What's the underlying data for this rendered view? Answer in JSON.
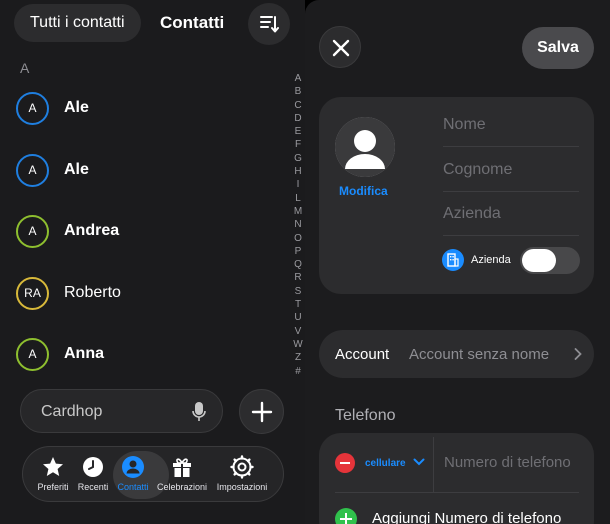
{
  "contacts_list": {
    "filter_label": "Tutti i contatti",
    "title": "Contatti",
    "section_letter": "A",
    "contacts": [
      {
        "initials": "A",
        "name": "Ale",
        "ring_color": "#1f7fe0"
      },
      {
        "initials": "A",
        "name": "Ale",
        "ring_color": "#1f7fe0"
      },
      {
        "initials": "A",
        "name": "Andrea",
        "ring_color": "#8ebf2f"
      },
      {
        "initials": "RA",
        "name": "Roberto",
        "ring_color": "#d8b93a"
      },
      {
        "initials": "A",
        "name": "Anna",
        "ring_color": "#8ebf2f"
      }
    ],
    "alphabet": [
      "A",
      "B",
      "C",
      "D",
      "E",
      "F",
      "G",
      "H",
      "I",
      "L",
      "M",
      "N",
      "O",
      "P",
      "Q",
      "R",
      "S",
      "T",
      "U",
      "V",
      "W",
      "Z",
      "#"
    ],
    "search_placeholder": "Cardhop",
    "tabs": [
      {
        "label": "Preferiti",
        "icon": "star-icon"
      },
      {
        "label": "Recenti",
        "icon": "clock-icon"
      },
      {
        "label": "Contatti",
        "icon": "person-icon",
        "active": true
      },
      {
        "label": "Celebrazioni",
        "icon": "gift-icon"
      },
      {
        "label": "Impostazioni",
        "icon": "gear-icon"
      }
    ]
  },
  "new_contact": {
    "save_label": "Salva",
    "edit_photo_label": "Modifica",
    "fields": {
      "first_name_placeholder": "Nome",
      "last_name_placeholder": "Cognome",
      "company_placeholder": "Azienda"
    },
    "company_toggle_label": "Azienda",
    "company_toggle_on": false,
    "account_label": "Account",
    "account_value": "Account senza nome",
    "phone_section_label": "Telefono",
    "phone_type": "cellulare",
    "phone_placeholder": "Numero di telefono",
    "add_phone_label": "Aggiungi Numero di telefono"
  },
  "colors": {
    "accent": "#1a8cff",
    "remove": "#e5343a",
    "add": "#30c14c"
  }
}
